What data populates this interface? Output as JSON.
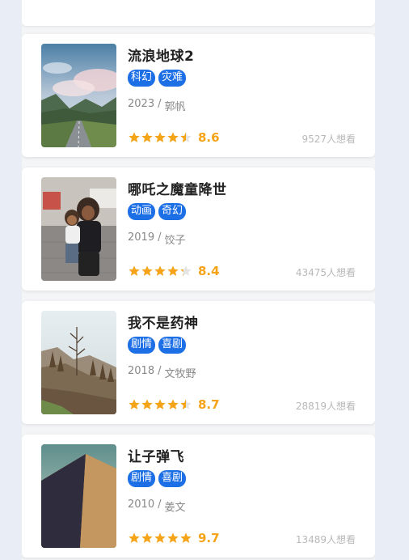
{
  "colors": {
    "accent": "#1d6fe6",
    "star": "#f5a317",
    "star_empty": "#e4e4e4",
    "page_bg": "#e9edf5"
  },
  "movies": [
    {
      "title": "流浪地球2",
      "tags": [
        "科幻",
        "灾难"
      ],
      "year": "2023",
      "separator": "/",
      "director": "郭帆",
      "stars": 4.5,
      "rating": "8.6",
      "wants": "9527人想看",
      "poster_icon": "mountain-road-poster"
    },
    {
      "title": "哪吒之魔童降世",
      "tags": [
        "动画",
        "奇幻"
      ],
      "year": "2019",
      "separator": "/",
      "director": "饺子",
      "stars": 4.5,
      "rating": "8.4",
      "wants": "43475人想看",
      "poster_icon": "mother-child-poster"
    },
    {
      "title": "我不是药神",
      "tags": [
        "剧情",
        "喜剧"
      ],
      "year": "2018",
      "separator": "/",
      "director": "文牧野",
      "stars": 4.5,
      "rating": "8.7",
      "wants": "28819人想看",
      "poster_icon": "foggy-forest-poster"
    },
    {
      "title": "让子弹飞",
      "tags": [
        "剧情",
        "喜剧"
      ],
      "year": "2010",
      "separator": "/",
      "director": "姜文",
      "stars": 5,
      "rating": "9.7",
      "wants": "13489人想看",
      "poster_icon": "sand-dune-poster"
    }
  ]
}
